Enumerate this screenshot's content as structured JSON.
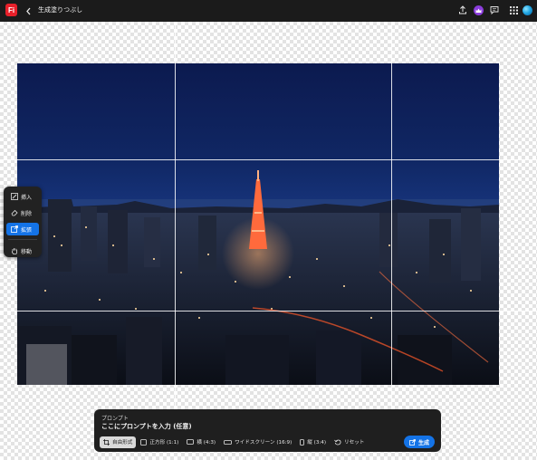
{
  "app": {
    "logo_text": "Fi",
    "title": "生成塗りつぶし"
  },
  "toolbar_icons": [
    "upload-icon",
    "crown-icon",
    "comment-icon",
    "apps-grid-icon",
    "avatar"
  ],
  "tools": [
    {
      "label": "挿入",
      "icon": "insert-brush-icon",
      "active": false
    },
    {
      "label": "削除",
      "icon": "eraser-icon",
      "active": false
    },
    {
      "label": "拡張",
      "icon": "expand-icon",
      "active": true
    },
    {
      "label": "移動",
      "icon": "hand-icon",
      "active": false
    }
  ],
  "prompt": {
    "label": "プロンプト",
    "placeholder": "ここにプロンプトを入力 (任意)",
    "value": ""
  },
  "ratios": [
    {
      "label": "自由形式",
      "icon": "crop-icon",
      "selected": true
    },
    {
      "label": "正方形 (1:1)",
      "icon": "square-icon",
      "selected": false
    },
    {
      "label": "横 (4:3)",
      "icon": "landscape-icon",
      "selected": false
    },
    {
      "label": "ワイドスクリーン (16:9)",
      "icon": "widescreen-icon",
      "selected": false
    },
    {
      "label": "縦 (3:4)",
      "icon": "portrait-icon",
      "selected": false
    },
    {
      "label": "リセット",
      "icon": "reset-icon",
      "selected": false
    }
  ],
  "generate_label": "生成",
  "colors": {
    "accent": "#1473e6",
    "topbar": "#1b1b1b",
    "panel": "#222222",
    "logo": "#e8202a"
  }
}
